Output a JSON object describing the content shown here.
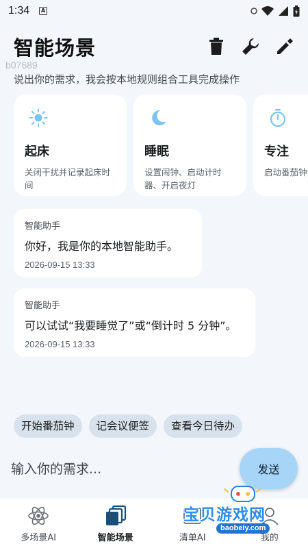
{
  "status_bar": {
    "time": "1:34",
    "notification_letter": "A"
  },
  "header": {
    "title": "智能场景",
    "actions": [
      "delete-icon",
      "wrench-icon",
      "edit-icon"
    ]
  },
  "watermark_id": "b07689",
  "subtitle": "说出你的需求，我会按本地规则组合工具完成操作",
  "cards": [
    {
      "icon": "sun-icon",
      "title": "起床",
      "desc": "关闭干扰并记录起床时间"
    },
    {
      "icon": "moon-icon",
      "title": "睡眠",
      "desc": "设置闹钟、启动计时器、开启夜灯"
    },
    {
      "icon": "timer-icon",
      "title": "专注",
      "desc": "启动番茄钟计完成"
    }
  ],
  "messages": [
    {
      "sender": "智能助手",
      "text": "你好，我是你的本地智能助手。",
      "time": "2026-09-15 13:33"
    },
    {
      "sender": "智能助手",
      "text": "可以试试“我要睡觉了”或“倒计时 5 分钟”。",
      "time": "2026-09-15 13:33"
    }
  ],
  "quick_chips": [
    "开始番茄钟",
    "记会议便签",
    "查看今日待办"
  ],
  "input": {
    "placeholder": "输入你的需求...",
    "value": "",
    "send_label": "发送"
  },
  "bottom_nav": [
    {
      "icon": "atom-icon",
      "label": "多场景AI",
      "active": false
    },
    {
      "icon": "layers-icon",
      "label": "智能场景",
      "active": true
    },
    {
      "icon": "list-icon",
      "label": "清单AI",
      "active": false
    },
    {
      "icon": "person-icon",
      "label": "我的",
      "active": false
    }
  ],
  "site_watermark": {
    "name": "宝贝游戏网",
    "url": "baobeiy.com"
  },
  "colors": {
    "background": "#f3f7fb",
    "card": "#ffffff",
    "chip": "#d7e2ec",
    "send_button": "#a7d5f7",
    "icon_blue": "#7cc3ef"
  }
}
